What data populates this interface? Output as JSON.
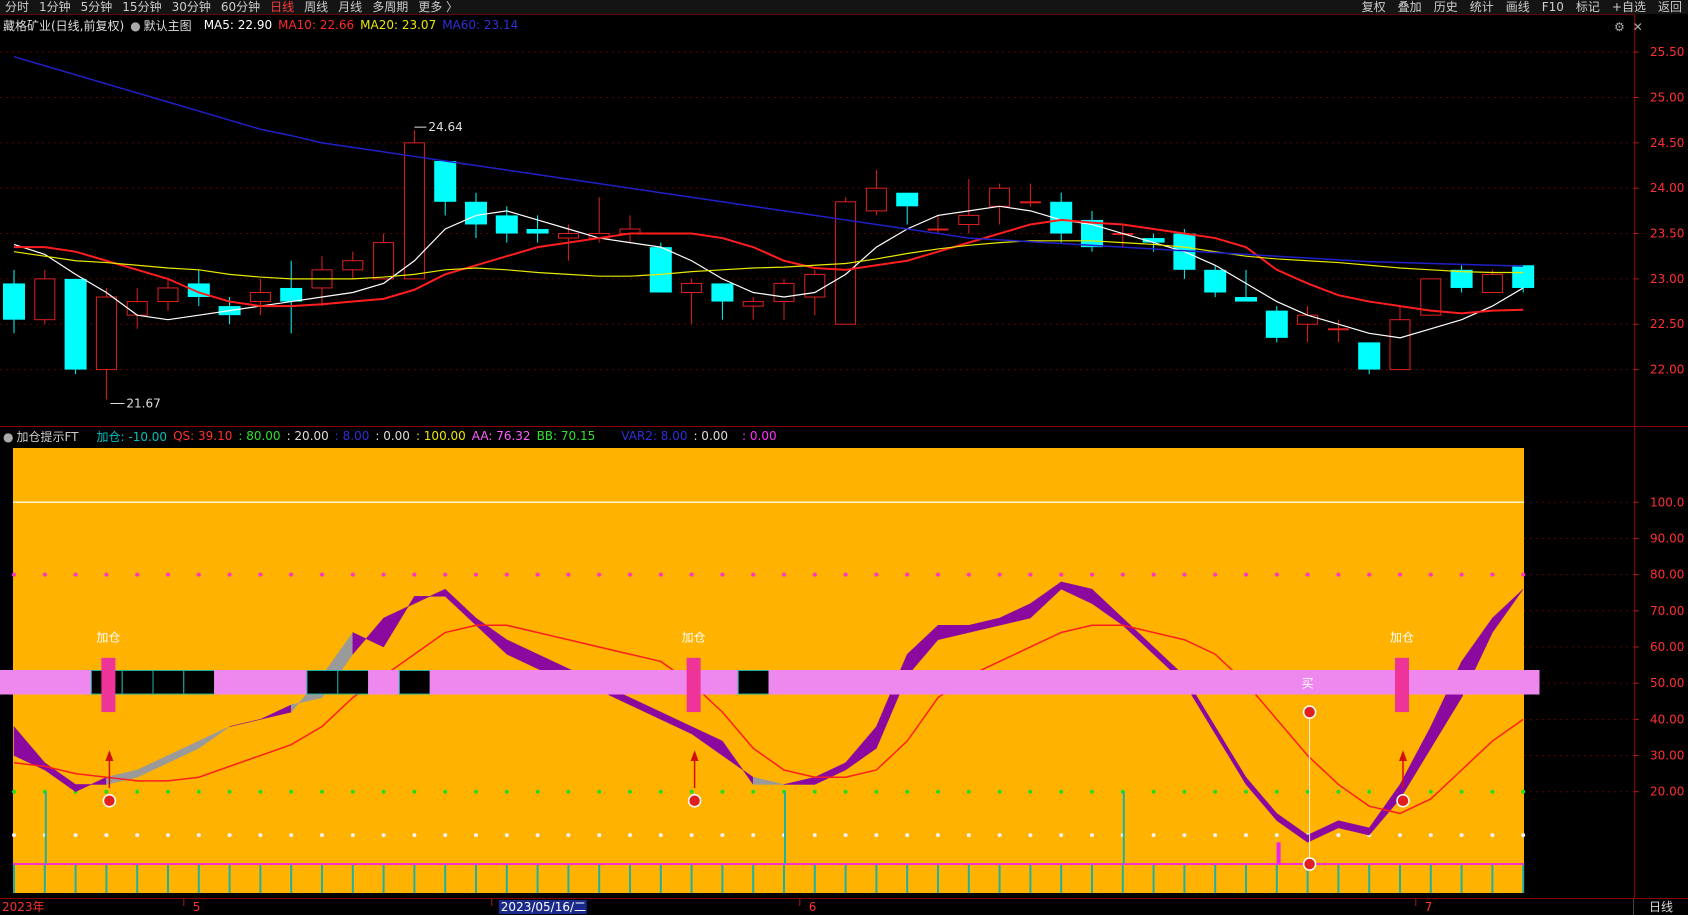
{
  "toolbar": {
    "periods": [
      "分时",
      "1分钟",
      "5分钟",
      "15分钟",
      "30分钟",
      "60分钟",
      "日线",
      "周线",
      "月线",
      "多周期",
      "更多 〉"
    ],
    "active_period": "日线",
    "right_tools": [
      "复权",
      "叠加",
      "历史",
      "统计",
      "画线",
      "F10",
      "标记",
      "+自选",
      "返回"
    ]
  },
  "main_legend": {
    "title": "藏格矿业(日线,前复权)",
    "overlay": "默认主图",
    "ma5": "MA5: 22.90",
    "ma10": "MA10: 22.66",
    "ma20": "MA20: 23.07",
    "ma60": "MA60: 23.14",
    "colors": {
      "ma5": "#ffffff",
      "ma10": "#ff2a2a",
      "ma20": "#e8e800",
      "ma60": "#2a2ad0",
      "up": "#e02020",
      "down": "#00ffff"
    }
  },
  "indicator_legend": {
    "title": "加仓提示FT",
    "jiacang": "加仓: -10.00",
    "qs": "QS: 39.10",
    "v80": ": 80.00",
    "v20": ": 20.00",
    "v8": ": 8.00",
    "v0a": ": 0.00",
    "v100": ": 100.00",
    "aa": "AA: 76.32",
    "bb": "BB: 70.15",
    "var2": "VAR2: 8.00",
    "v0b": ": 0.00",
    "v0c": ": 0.00"
  },
  "panel_controls": {
    "settings": "⚙",
    "close": "✕",
    "gear_icon": "gear-icon",
    "close_icon": "close-icon"
  },
  "bottom_status": "日线",
  "chart_data": [
    {
      "type": "candlestick",
      "name": "藏格矿业(日线,前复权)",
      "ylim": [
        21.4,
        25.7
      ],
      "y_ticks": [
        "25.50",
        "25.00",
        "24.50",
        "24.00",
        "23.50",
        "23.00",
        "22.50",
        "22.00"
      ],
      "x_labels": [
        {
          "index": 0,
          "text": "2023年"
        },
        {
          "index": 6,
          "text": "5"
        },
        {
          "index": 16,
          "text": "2023/05/16/二"
        },
        {
          "index": 26,
          "text": "6"
        },
        {
          "index": 46,
          "text": "7"
        }
      ],
      "annotations": [
        {
          "index": 13,
          "value": 24.64,
          "text": "24.64"
        },
        {
          "index": 3,
          "value": 21.67,
          "text": "21.67"
        }
      ],
      "candles": [
        [
          22.95,
          22.55,
          23.1,
          22.4
        ],
        [
          22.55,
          23.0,
          23.1,
          22.5
        ],
        [
          23.0,
          22.0,
          23.0,
          21.95
        ],
        [
          22.0,
          22.8,
          22.9,
          21.67
        ],
        [
          22.6,
          22.75,
          22.9,
          22.45
        ],
        [
          22.75,
          22.9,
          23.0,
          22.65
        ],
        [
          22.95,
          22.8,
          23.1,
          22.7
        ],
        [
          22.7,
          22.6,
          22.8,
          22.5
        ],
        [
          22.75,
          22.85,
          23.0,
          22.6
        ],
        [
          22.9,
          22.75,
          23.2,
          22.4
        ],
        [
          22.9,
          23.1,
          23.25,
          22.7
        ],
        [
          23.1,
          23.2,
          23.3,
          23.0
        ],
        [
          23.0,
          23.4,
          23.5,
          23.0
        ],
        [
          23.0,
          24.5,
          24.64,
          23.0
        ],
        [
          24.3,
          23.85,
          24.3,
          23.7
        ],
        [
          23.85,
          23.6,
          23.95,
          23.45
        ],
        [
          23.7,
          23.5,
          23.8,
          23.4
        ],
        [
          23.55,
          23.5,
          23.7,
          23.4
        ],
        [
          23.45,
          23.5,
          23.6,
          23.2
        ],
        [
          23.45,
          23.5,
          23.9,
          23.4
        ],
        [
          23.5,
          23.55,
          23.7,
          23.4
        ],
        [
          23.35,
          22.85,
          23.4,
          22.85
        ],
        [
          22.85,
          22.95,
          23.0,
          22.5
        ],
        [
          22.95,
          22.75,
          22.95,
          22.55
        ],
        [
          22.7,
          22.75,
          22.8,
          22.55
        ],
        [
          22.75,
          22.95,
          23.0,
          22.55
        ],
        [
          22.8,
          23.05,
          23.1,
          22.6
        ],
        [
          22.5,
          23.85,
          23.9,
          22.5
        ],
        [
          23.75,
          24.0,
          24.2,
          23.7
        ],
        [
          23.95,
          23.8,
          23.95,
          23.6
        ],
        [
          23.55,
          23.55,
          23.7,
          23.5
        ],
        [
          23.6,
          23.7,
          24.1,
          23.5
        ],
        [
          23.8,
          24.0,
          24.05,
          23.6
        ],
        [
          23.85,
          23.85,
          24.05,
          23.8
        ],
        [
          23.85,
          23.5,
          23.95,
          23.4
        ],
        [
          23.65,
          23.35,
          23.75,
          23.3
        ],
        [
          23.5,
          23.5,
          23.6,
          23.35
        ],
        [
          23.45,
          23.4,
          23.5,
          23.3
        ],
        [
          23.5,
          23.1,
          23.55,
          23.0
        ],
        [
          23.1,
          22.85,
          23.15,
          22.8
        ],
        [
          22.8,
          22.75,
          23.1,
          22.75
        ],
        [
          22.65,
          22.35,
          22.7,
          22.3
        ],
        [
          22.5,
          22.6,
          22.7,
          22.3
        ],
        [
          22.45,
          22.45,
          22.55,
          22.3
        ],
        [
          22.3,
          22.0,
          22.3,
          21.95
        ],
        [
          22.0,
          22.55,
          22.7,
          22.0
        ],
        [
          22.6,
          23.0,
          23.0,
          22.6
        ],
        [
          23.1,
          22.9,
          23.15,
          22.85
        ],
        [
          22.85,
          23.05,
          23.1,
          22.85
        ],
        [
          23.15,
          22.9,
          23.15,
          22.85
        ]
      ],
      "series": [
        {
          "name": "MA5",
          "values": [
            23.38,
            23.27,
            23.05,
            22.85,
            22.6,
            22.55,
            22.6,
            22.65,
            22.7,
            22.75,
            22.8,
            22.85,
            22.95,
            23.2,
            23.55,
            23.7,
            23.75,
            23.65,
            23.55,
            23.45,
            23.4,
            23.35,
            23.2,
            23.0,
            22.85,
            22.8,
            22.85,
            23.05,
            23.35,
            23.55,
            23.7,
            23.75,
            23.8,
            23.75,
            23.65,
            23.6,
            23.5,
            23.4,
            23.3,
            23.15,
            22.95,
            22.75,
            22.6,
            22.5,
            22.4,
            22.35,
            22.45,
            22.55,
            22.7,
            22.9
          ]
        },
        {
          "name": "MA10",
          "values": [
            23.35,
            23.35,
            23.3,
            23.2,
            23.1,
            23.0,
            22.85,
            22.75,
            22.7,
            22.7,
            22.72,
            22.75,
            22.78,
            22.88,
            23.05,
            23.15,
            23.25,
            23.35,
            23.4,
            23.45,
            23.5,
            23.5,
            23.5,
            23.45,
            23.35,
            23.2,
            23.12,
            23.1,
            23.15,
            23.2,
            23.3,
            23.4,
            23.5,
            23.6,
            23.65,
            23.62,
            23.6,
            23.55,
            23.5,
            23.45,
            23.35,
            23.1,
            22.95,
            22.82,
            22.75,
            22.7,
            22.65,
            22.62,
            22.65,
            22.66
          ]
        },
        {
          "name": "MA20",
          "values": [
            23.3,
            23.25,
            23.2,
            23.18,
            23.15,
            23.12,
            23.1,
            23.05,
            23.02,
            23.0,
            23.0,
            23.0,
            23.02,
            23.05,
            23.1,
            23.12,
            23.1,
            23.07,
            23.05,
            23.03,
            23.03,
            23.05,
            23.08,
            23.1,
            23.12,
            23.13,
            23.15,
            23.17,
            23.22,
            23.28,
            23.33,
            23.37,
            23.4,
            23.42,
            23.42,
            23.42,
            23.4,
            23.38,
            23.35,
            23.3,
            23.25,
            23.22,
            23.2,
            23.18,
            23.15,
            23.12,
            23.1,
            23.08,
            23.07,
            23.07
          ]
        },
        {
          "name": "MA60",
          "values": [
            25.45,
            25.35,
            25.25,
            25.15,
            25.05,
            24.95,
            24.85,
            24.75,
            24.65,
            24.58,
            24.5,
            24.45,
            24.4,
            24.35,
            24.3,
            24.25,
            24.2,
            24.15,
            24.1,
            24.05,
            24.0,
            23.95,
            23.9,
            23.85,
            23.8,
            23.75,
            23.7,
            23.65,
            23.6,
            23.55,
            23.5,
            23.45,
            23.43,
            23.41,
            23.39,
            23.37,
            23.35,
            23.33,
            23.31,
            23.29,
            23.27,
            23.25,
            23.23,
            23.21,
            23.19,
            23.18,
            23.17,
            23.16,
            23.15,
            23.14
          ]
        }
      ]
    },
    {
      "type": "indicator",
      "name": "加仓提示FT",
      "ylim": [
        -8,
        115
      ],
      "y_ticks": [
        "100.0",
        "90.00",
        "80.00",
        "70.00",
        "60.00",
        "50.00",
        "40.00",
        "30.00",
        "20.00"
      ],
      "series": [
        {
          "name": "AA",
          "values": [
            38,
            28,
            22,
            22,
            24,
            28,
            32,
            38,
            40,
            44,
            46,
            58,
            68,
            72,
            76,
            68,
            62,
            58,
            54,
            50,
            46,
            42,
            38,
            34,
            22,
            22,
            24,
            28,
            38,
            58,
            66,
            66,
            68,
            72,
            78,
            76,
            68,
            60,
            52,
            38,
            24,
            14,
            8,
            12,
            10,
            22,
            38,
            56,
            68,
            76
          ]
        },
        {
          "name": "BB",
          "values": [
            30,
            26,
            20,
            24,
            26,
            30,
            34,
            38,
            40,
            42,
            52,
            64,
            60,
            74,
            74,
            66,
            58,
            54,
            50,
            48,
            44,
            40,
            36,
            30,
            24,
            22,
            22,
            26,
            32,
            52,
            62,
            64,
            66,
            68,
            76,
            72,
            66,
            58,
            50,
            36,
            22,
            12,
            6,
            10,
            8,
            18,
            32,
            46,
            64,
            76
          ]
        },
        {
          "name": "QS",
          "values": [
            28,
            27,
            25,
            24,
            23,
            23,
            24,
            27,
            30,
            33,
            38,
            46,
            52,
            58,
            64,
            66,
            66,
            64,
            62,
            60,
            58,
            56,
            50,
            42,
            32,
            26,
            24,
            24,
            26,
            34,
            46,
            52,
            56,
            60,
            64,
            66,
            66,
            64,
            62,
            58,
            50,
            40,
            30,
            22,
            16,
            14,
            18,
            26,
            34,
            40
          ]
        }
      ],
      "signals": [
        {
          "index": 3,
          "label": "加仓"
        },
        {
          "index": 22,
          "label": "加仓"
        },
        {
          "index": 45,
          "label": "加仓"
        }
      ],
      "band_label": {
        "index": 42,
        "text": "买"
      }
    }
  ]
}
